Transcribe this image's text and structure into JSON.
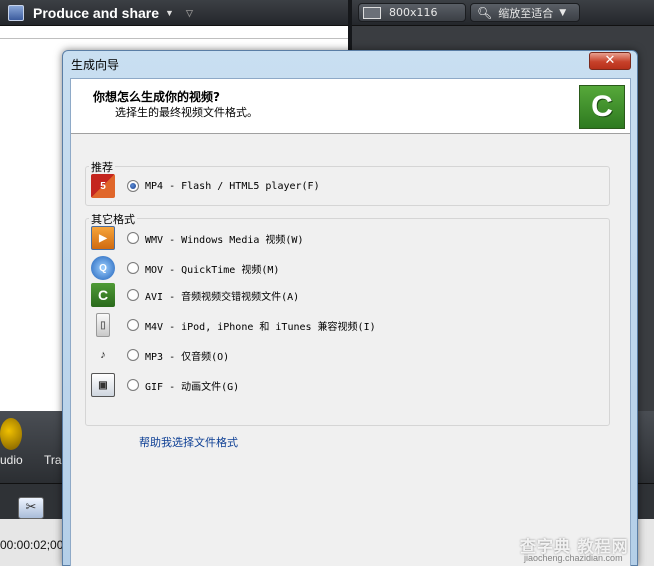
{
  "app": {
    "produce_label": "Produce and share",
    "dimensions": "800x116",
    "zoom": "缩放至适合",
    "audio_label": "udio",
    "track_label": "Tra",
    "timecode": "00:00:02;00"
  },
  "dialog": {
    "title": "生成向导",
    "close_glyph": "✕",
    "question": "你想怎么生成你的视频?",
    "subtitle": "选择生的最终视频文件格式。",
    "logo_letter": "C",
    "recommended_label": "推荐",
    "recommended": {
      "label": "MP4 - Flash / HTML5 player(F)",
      "icon": "html5-flash-icon",
      "selected": true
    },
    "other_label": "其它格式",
    "other_formats": [
      {
        "label": "WMV - Windows Media 视频(W)",
        "icon": "windows-media-icon"
      },
      {
        "label": "MOV - QuickTime 视频(M)",
        "icon": "quicktime-icon"
      },
      {
        "label": "AVI - 音频视频交错视频文件(A)",
        "icon": "avi-icon"
      },
      {
        "label": "M4V - iPod, iPhone 和 iTunes 兼容视频(I)",
        "icon": "ipod-icon"
      },
      {
        "label": "MP3 - 仅音频(O)",
        "icon": "mp3-icon"
      },
      {
        "label": "GIF - 动画文件(G)",
        "icon": "gif-icon"
      }
    ],
    "help_link": "帮助我选择文件格式"
  },
  "watermark": {
    "main": "查字典 教程网",
    "sub": "jiaocheng.chazidian.com"
  }
}
